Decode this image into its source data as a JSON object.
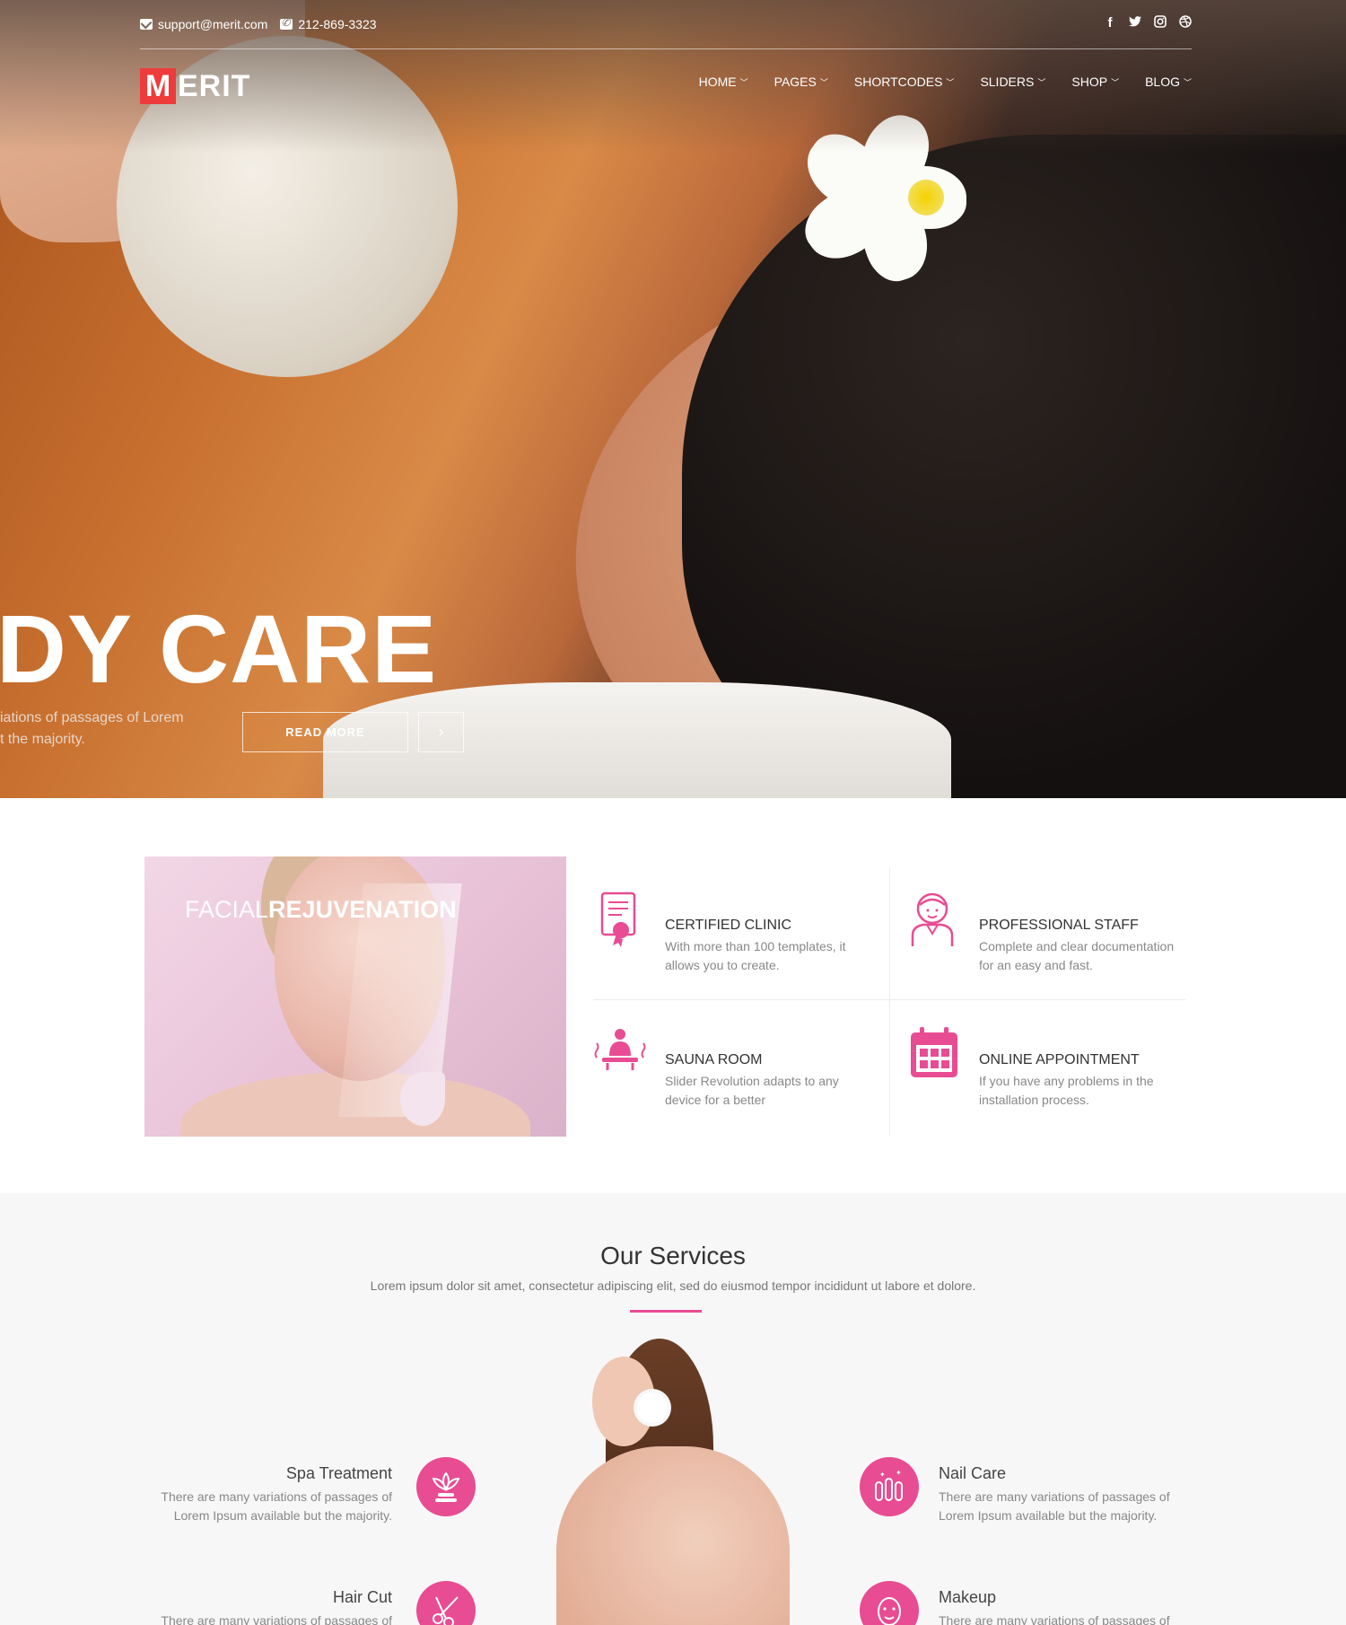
{
  "topbar": {
    "email": "support@merit.com",
    "phone": "212-869-3323",
    "social": [
      "facebook-icon",
      "twitter-icon",
      "instagram-icon",
      "dribbble-icon"
    ]
  },
  "logo": {
    "first_letter": "M",
    "rest": "ERIT"
  },
  "nav": {
    "items": [
      {
        "label": "HOME"
      },
      {
        "label": "PAGES"
      },
      {
        "label": "SHORTCODES"
      },
      {
        "label": "SLIDERS"
      },
      {
        "label": "SHOP"
      },
      {
        "label": "BLOG"
      }
    ]
  },
  "hero": {
    "title": "DY CARE",
    "subtitle_line1": "iations of passages of Lorem",
    "subtitle_line2": "t the majority.",
    "read_more": "READ MORE",
    "next_glyph": "›"
  },
  "facial": {
    "title_light": "FACIAL",
    "title_bold": "REJUVENATION"
  },
  "features": [
    {
      "title": "CERTIFIED CLINIC",
      "text": "With more than 100 templates, it allows you to create.",
      "icon": "certificate-icon"
    },
    {
      "title": "PROFESSIONAL STAFF",
      "text": "Complete and clear documentation for an easy and fast.",
      "icon": "staff-icon"
    },
    {
      "title": "SAUNA ROOM",
      "text": "Slider Revolution adapts to any device for a better",
      "icon": "sauna-icon"
    },
    {
      "title": "ONLINE APPOINTMENT",
      "text": "If you have any problems in the installation process.",
      "icon": "calendar-icon"
    }
  ],
  "services": {
    "heading": "Our Services",
    "subheading": "Lorem ipsum dolor sit amet, consectetur adipiscing elit, sed do eiusmod tempor incididunt ut labore et dolore.",
    "items": [
      {
        "title": "Spa Treatment",
        "text": "There are many variations of passages of Lorem Ipsum available but the majority.",
        "icon": "lotus-icon"
      },
      {
        "title": "Nail Care",
        "text": "There are many variations of passages of Lorem Ipsum available but the majority.",
        "icon": "nail-icon"
      },
      {
        "title": "Hair Cut",
        "text": "There are many variations of passages of",
        "icon": "scissors-icon"
      },
      {
        "title": "Makeup",
        "text": "There are many variations of passages of",
        "icon": "makeup-icon"
      }
    ]
  },
  "colors": {
    "accent": "#e84c92",
    "logo_red": "#ee3b3b"
  }
}
